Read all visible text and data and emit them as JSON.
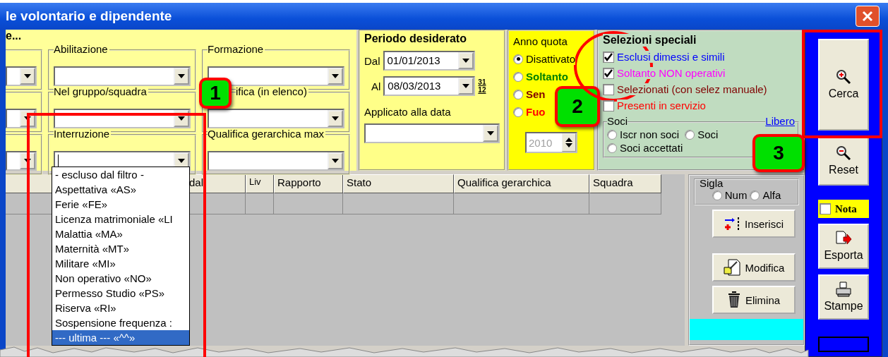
{
  "window": {
    "title": "le volontario e dipendente"
  },
  "filters": {
    "group_label": "e...",
    "fields": [
      {
        "kind": "bare"
      },
      {
        "kind": "combo",
        "label": "Abilitazione"
      },
      {
        "kind": "combo",
        "label": "Formazione"
      },
      {
        "kind": "bare"
      },
      {
        "kind": "combo",
        "label": "Nel gruppo/squadra"
      },
      {
        "kind": "combo",
        "label": "ifica (in elenco)"
      },
      {
        "kind": "bare"
      },
      {
        "kind": "editing",
        "label": "Interruzione"
      },
      {
        "kind": "combo",
        "label": "Qualifica gerarchica max"
      }
    ]
  },
  "periodo": {
    "title": "Periodo desiderato",
    "from_label": "Dal",
    "from": "01/01/2013",
    "to_label": "Al",
    "to": "08/03/2013",
    "calendar_button": {
      "day": "31",
      "month": "12"
    },
    "applied_label": "Applicato alla data"
  },
  "anno_quota": {
    "title": "Anno quota",
    "options": [
      {
        "label": "Disattivato",
        "selected": true,
        "color": "#000000"
      },
      {
        "label": "Soltanto",
        "selected": false,
        "color": "#008000"
      },
      {
        "label": "Sen",
        "selected": false,
        "color": "#800000"
      },
      {
        "label": "Fuo",
        "selected": false,
        "color": "#ff0000"
      }
    ],
    "year": "2010",
    "year_disabled": true
  },
  "selezioni": {
    "title": "Selezioni speciali",
    "checks": [
      {
        "label": "Esclusi dimessi e simili",
        "checked": true,
        "color": "#0000ff"
      },
      {
        "label": "Soltanto NON operativi",
        "checked": true,
        "color": "#ff00ff"
      },
      {
        "label": "Selezionati (con selez manuale)",
        "checked": false,
        "color": "#800000"
      },
      {
        "label": "Presenti in servizio",
        "checked": false,
        "color": "#ff0000"
      }
    ],
    "soci_title": "Soci",
    "link": "Libero",
    "soci": [
      {
        "label": "Iscr non soci",
        "selected": false
      },
      {
        "label": "Soci",
        "selected": false
      },
      {
        "label": "Soci accettati",
        "selected": false
      }
    ]
  },
  "actions": [
    {
      "kind": "search",
      "label": "Cerca"
    },
    {
      "kind": "reset",
      "label": "Reset"
    },
    {
      "kind": "check",
      "label": "Nota",
      "checked": false
    },
    {
      "kind": "export",
      "label": "Esporta"
    },
    {
      "kind": "print",
      "label": "Stampe"
    }
  ],
  "table": {
    "columns": [
      "dal",
      "Liv",
      "Rapporto",
      "Stato",
      "Qualifica gerarchica",
      "Squadra"
    ]
  },
  "sigla": {
    "title": "Sigla",
    "options": [
      {
        "label": "Num",
        "selected": false
      },
      {
        "label": "Alfa",
        "selected": false
      }
    ],
    "buttons": [
      {
        "kind": "insert",
        "label": "Inserisci"
      },
      {
        "kind": "edit",
        "label": "Modifica"
      },
      {
        "kind": "delete",
        "label": "Elimina"
      }
    ]
  },
  "dropdown": {
    "items": [
      {
        "label": "- escluso dal filtro -",
        "selected": false
      },
      {
        "label": "Aspettativa «AS»",
        "selected": false
      },
      {
        "label": "Ferie «FE»",
        "selected": false
      },
      {
        "label": "Licenza matrimoniale «LI",
        "selected": false
      },
      {
        "label": "Malattia «MA»",
        "selected": false
      },
      {
        "label": "Maternità «MT»",
        "selected": false
      },
      {
        "label": "Militare «MI»",
        "selected": false
      },
      {
        "label": "Non operativo «NO»",
        "selected": false
      },
      {
        "label": "Permesso Studio «PS»",
        "selected": false
      },
      {
        "label": "Riserva «RI»",
        "selected": false
      },
      {
        "label": "Sospensione frequenza :",
        "selected": false
      },
      {
        "label": "--- ultima --- «^^»",
        "selected": true
      }
    ]
  },
  "callouts": [
    "1",
    "2",
    "3"
  ]
}
